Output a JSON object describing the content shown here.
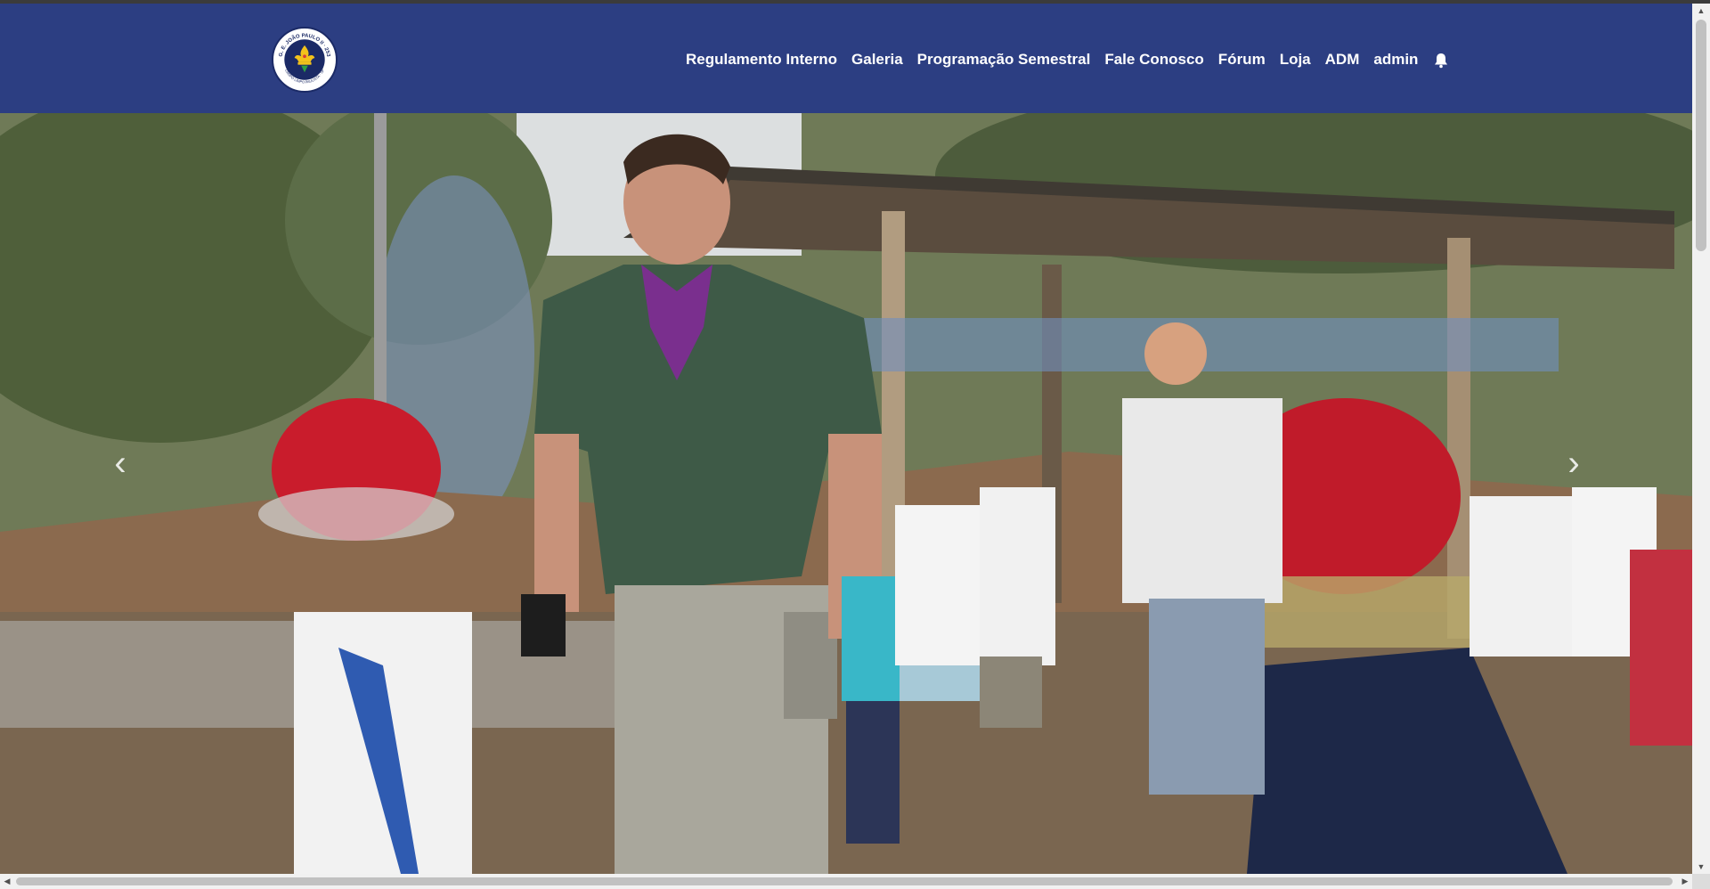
{
  "brand": {
    "logo_text_top": "G. E. JOÃO PAULO II · 253",
    "logo_text_bottom": "CAMPO LIMPO PAULISTA · SP"
  },
  "nav": {
    "items": [
      {
        "label": "Regulamento Interno"
      },
      {
        "label": "Galeria"
      },
      {
        "label": "Programação Semestral"
      },
      {
        "label": "Fale Conosco"
      },
      {
        "label": "Fórum"
      },
      {
        "label": "Loja"
      },
      {
        "label": "ADM"
      },
      {
        "label": "admin"
      }
    ],
    "notification_icon": "bell-icon"
  },
  "hero": {
    "image_alt": "Scout leader with children wearing firefighter helmets at a campsite",
    "prev_icon": "chevron-left-icon",
    "next_icon": "chevron-right-icon",
    "prev_glyph": "‹",
    "next_glyph": "›"
  },
  "colors": {
    "navbar_bg": "#2c3e82",
    "nav_text": "#ffffff"
  }
}
